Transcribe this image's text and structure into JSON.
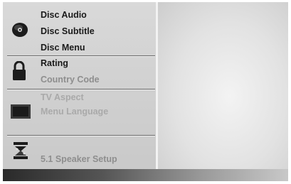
{
  "menu": {
    "groups": [
      {
        "icon": "disc-icon",
        "items": [
          {
            "label": "Disc Audio"
          },
          {
            "label": "Disc Subtitle"
          },
          {
            "label": "Disc Menu"
          }
        ]
      },
      {
        "icon": "padlock-icon",
        "items": [
          {
            "label": "Rating"
          },
          {
            "label": "Country Code"
          }
        ]
      },
      {
        "icon": "tv-screen-icon",
        "items": [
          {
            "label": "TV Aspect"
          },
          {
            "label": "Menu Language"
          }
        ]
      },
      {
        "icon": "speaker-setup-icon",
        "items": [
          {
            "label": "5.1 Speaker Setup"
          }
        ]
      }
    ]
  },
  "colors": {
    "active_text": "#1a1a1a",
    "dim_text": "#8e8e8e",
    "panel_bg": "#d4d4d4"
  }
}
